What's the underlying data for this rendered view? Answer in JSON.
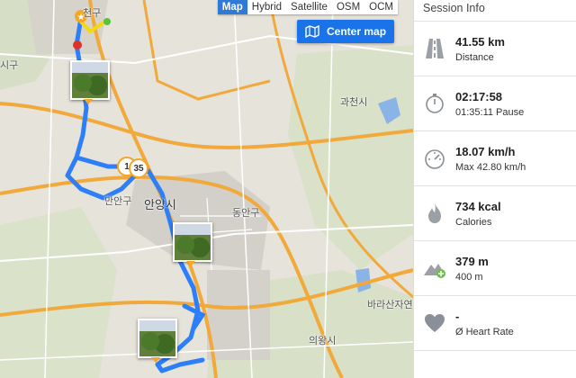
{
  "map": {
    "types": [
      "Map",
      "Hybrid",
      "Satellite",
      "OSM",
      "OCM"
    ],
    "active_type": "Map",
    "center_button": "Center map",
    "labels": [
      "천구",
      "시구",
      "과천시",
      "만안구",
      "안양시",
      "동안구",
      "바라산자연",
      "의왕시"
    ],
    "km_markers": [
      "1",
      "35"
    ],
    "route_color": "#2d7ff9"
  },
  "panel": {
    "title": "Session Info",
    "stats": [
      {
        "icon": "road-icon",
        "main": "41.55 km",
        "sub": "Distance"
      },
      {
        "icon": "stopwatch-icon",
        "main": "02:17:58",
        "sub": "01:35:11 Pause"
      },
      {
        "icon": "speedometer-icon",
        "main": "18.07 km/h",
        "sub": "Max 42.80 km/h"
      },
      {
        "icon": "flame-icon",
        "main": "734 kcal",
        "sub": "Calories"
      },
      {
        "icon": "mountain-icon",
        "main": "379 m",
        "sub": "400 m"
      },
      {
        "icon": "heart-icon",
        "main": "-",
        "sub": "Ø Heart Rate"
      }
    ]
  }
}
